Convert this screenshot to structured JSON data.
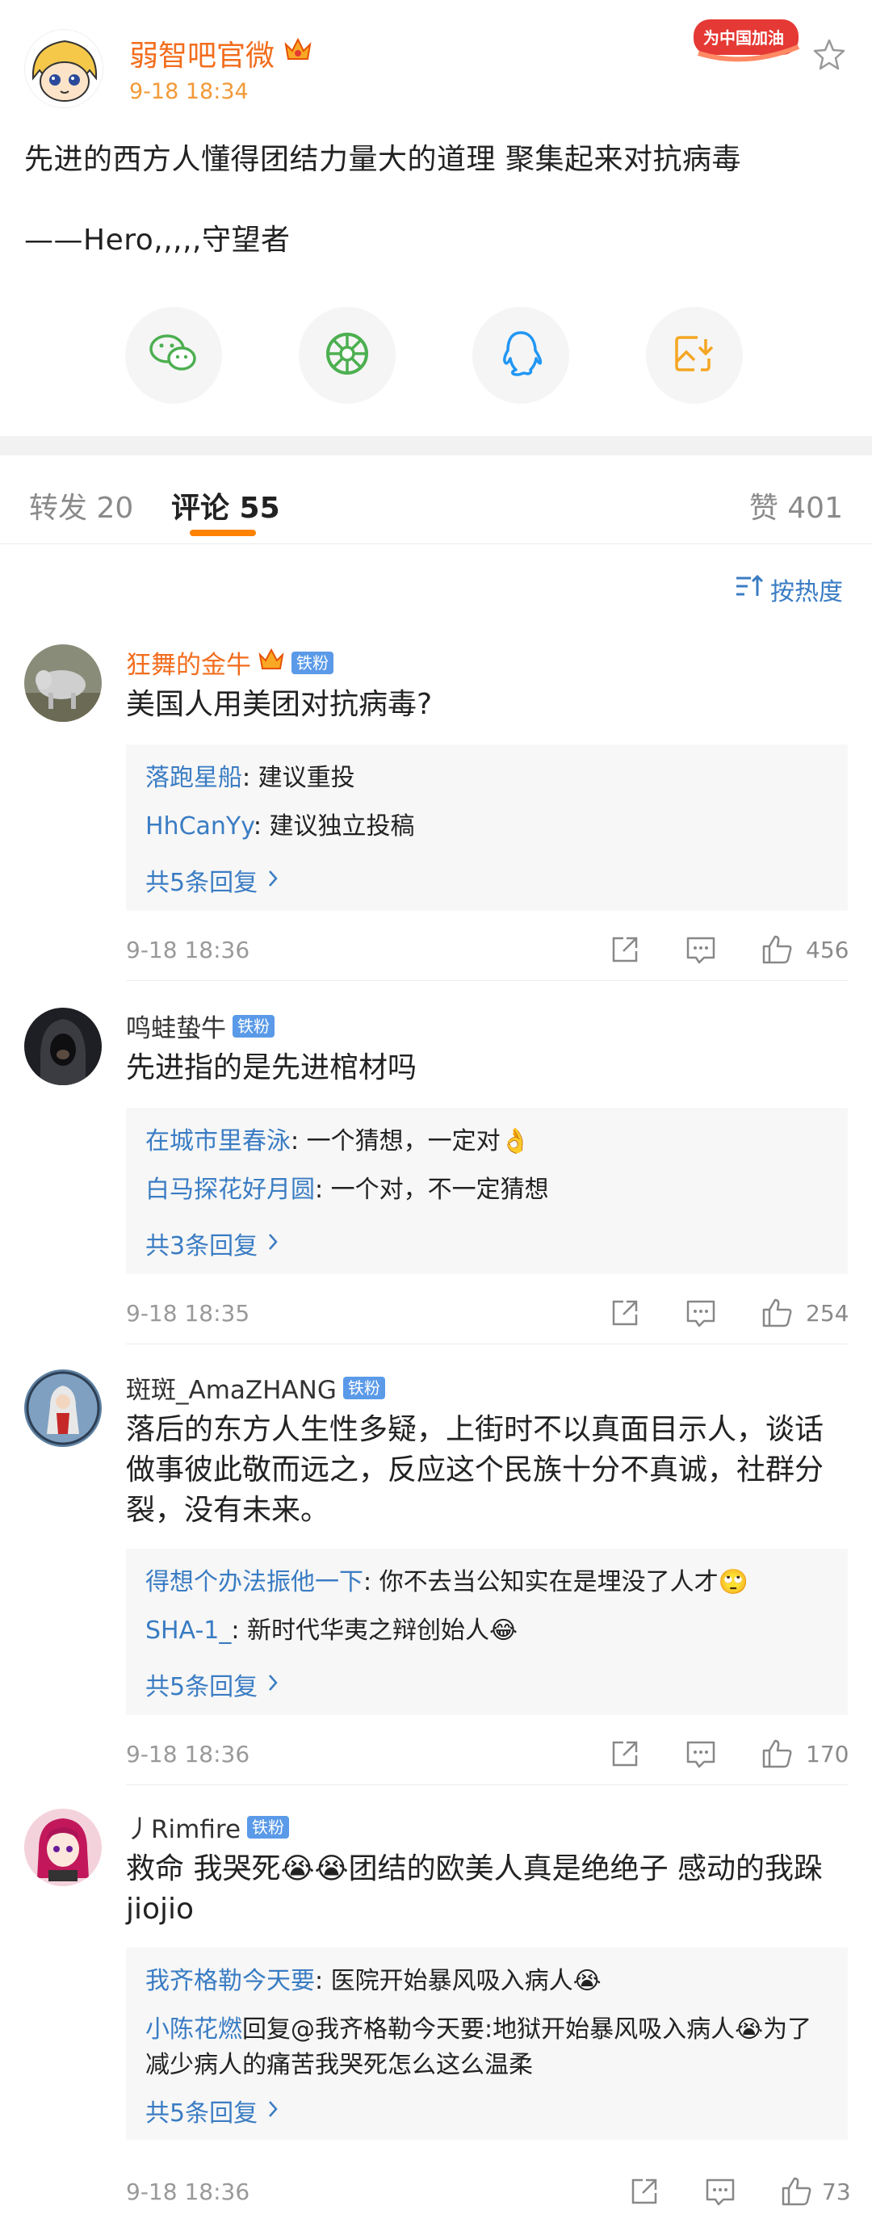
{
  "post": {
    "author": "弱智吧官微",
    "time": "9-18 18:34",
    "promo_badge": "为中国加油",
    "text_line1": "先进的西方人懂得团结力量大的道理 聚集起来对抗病毒",
    "text_line2": "——Hero,,,,,守望者",
    "share": [
      {
        "icon": "wechat-icon"
      },
      {
        "icon": "moments-icon"
      },
      {
        "icon": "qq-icon"
      },
      {
        "icon": "save-image-icon"
      }
    ]
  },
  "tabs": {
    "repost": "转发 20",
    "comments": "评论 55",
    "likes": "赞 401"
  },
  "sort_label": "按热度",
  "comments": [
    {
      "name": "狂舞的金牛",
      "badge": "铁粉",
      "text": "美国人用美团对抗病毒?",
      "replies": [
        {
          "user": "落跑星船",
          "text": ": 建议重投"
        },
        {
          "user": "HhCanYy",
          "text": ": 建议独立投稿"
        }
      ],
      "more": "共5条回复",
      "date": "9-18 18:36",
      "likes": "456"
    },
    {
      "name": "鸣蛙蛰牛",
      "badge": "铁粉",
      "text": "先进指的是先进棺材吗",
      "replies": [
        {
          "user": "在城市里春泳",
          "text": ": 一个猜想，一定对👌"
        },
        {
          "user": "白马探花好月圆",
          "text": ": 一个对，不一定猜想"
        }
      ],
      "more": "共3条回复",
      "date": "9-18 18:35",
      "likes": "254"
    },
    {
      "name": "斑斑_AmaZHANG",
      "badge": "铁粉",
      "text": "落后的东方人生性多疑，上街时不以真面目示人，谈话做事彼此敬而远之，反应这个民族十分不真诚，社群分裂，没有未来。",
      "replies": [
        {
          "user": "得想个办法振他一下",
          "text": ": 你不去当公知实在是埋没了人才🙄"
        },
        {
          "user": "SHA-1_",
          "text": ": 新时代华夷之辩创始人😂"
        }
      ],
      "more": "共5条回复",
      "date": "9-18 18:36",
      "likes": "170"
    },
    {
      "name": "丿Rimfire",
      "badge": "铁粉",
      "text": "救命 我哭死😭😭团结的欧美人真是绝绝子 感动的我跺jiojio",
      "replies": [
        {
          "user": "我齐格勒今天要",
          "text": ": 医院开始暴风吸入病人😭"
        },
        {
          "user": "小陈花燃",
          "text": "回复@我齐格勒今天要:地狱开始暴风吸入病人😭为了减少病人的痛苦我哭死怎么这么温柔",
          "mention": "@我齐格勒今天要"
        }
      ],
      "more": "共5条回复",
      "date": "9-18 18:36",
      "likes": "73"
    }
  ]
}
